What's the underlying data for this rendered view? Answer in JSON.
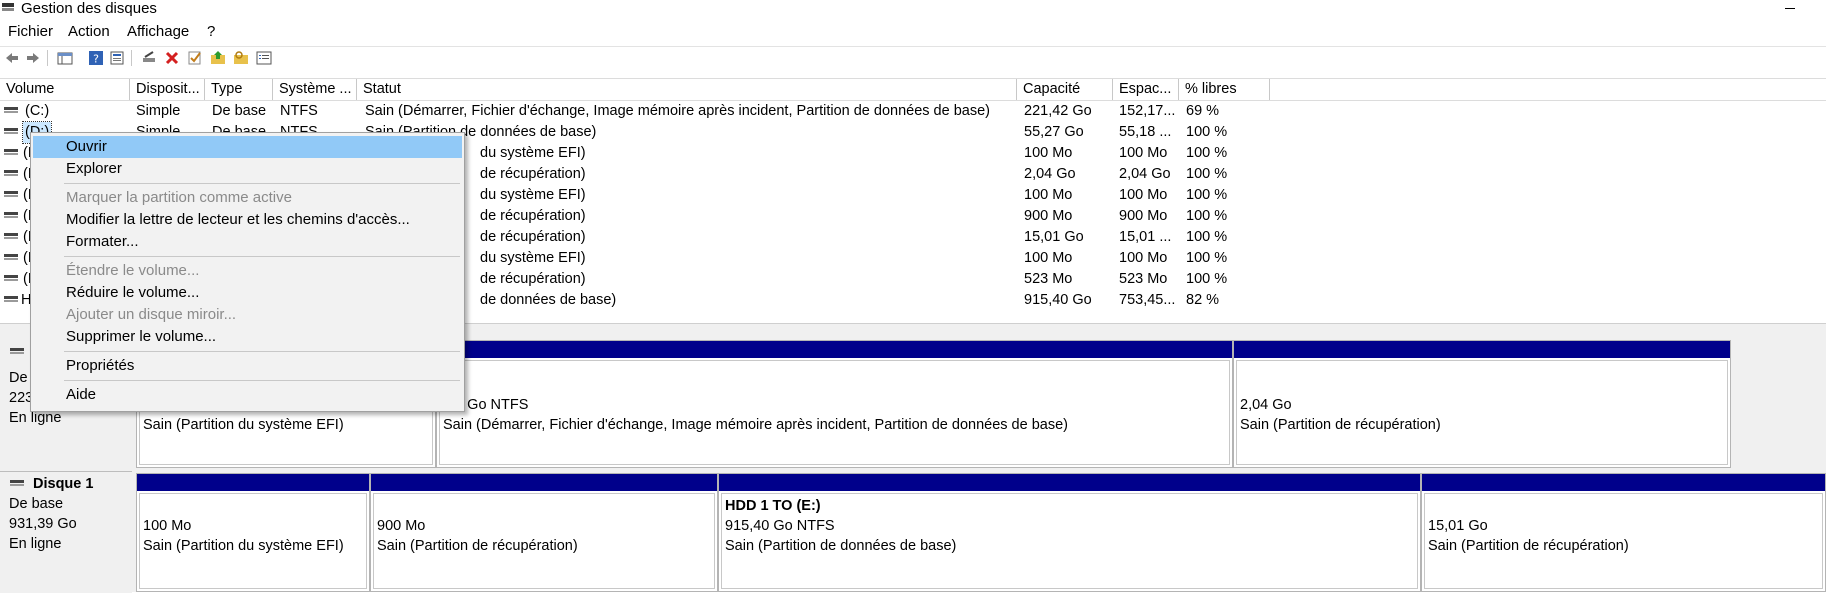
{
  "window": {
    "title": "Gestion des disques"
  },
  "menubar": [
    "Fichier",
    "Action",
    "Affichage",
    "?"
  ],
  "toolbar": {
    "icons": [
      "back-arrow-icon",
      "forward-arrow-icon",
      "console-tree-icon",
      "help-icon",
      "properties-icon",
      "connect-icon",
      "delete-icon",
      "check-icon",
      "folder-up-icon",
      "folder-key-icon",
      "list-icon"
    ]
  },
  "volume_list": {
    "columns": [
      "Volume",
      "Disposit...",
      "Type",
      "Système ...",
      "Statut",
      "Capacité",
      "Espac...",
      "% libres"
    ],
    "rows": [
      [
        "(C:)",
        "Simple",
        "De base",
        "NTFS",
        "Sain (Démarrer, Fichier d'échange, Image mémoire après incident, Partition de données de base)",
        "221,42 Go",
        "152,17...",
        "69 %"
      ],
      [
        "(D:)",
        "Simple",
        "De base",
        "NTFS",
        "Sain (Partition de données de base)",
        "55,27 Go",
        "55,18 ...",
        "100 %"
      ],
      [
        "(D",
        "",
        "",
        "",
        "du système EFI)",
        "100 Mo",
        "100 Mo",
        "100 %"
      ],
      [
        "(D",
        "",
        "",
        "",
        "de récupération)",
        "2,04 Go",
        "2,04 Go",
        "100 %"
      ],
      [
        "(D",
        "",
        "",
        "",
        "du système EFI)",
        "100 Mo",
        "100 Mo",
        "100 %"
      ],
      [
        "(D",
        "",
        "",
        "",
        "de récupération)",
        "900 Mo",
        "900 Mo",
        "100 %"
      ],
      [
        "(D",
        "",
        "",
        "",
        "de récupération)",
        "15,01 Go",
        "15,01 ...",
        "100 %"
      ],
      [
        "(D",
        "",
        "",
        "",
        "du système EFI)",
        "100 Mo",
        "100 Mo",
        "100 %"
      ],
      [
        "(D",
        "",
        "",
        "",
        "de récupération)",
        "523 Mo",
        "523 Mo",
        "100 %"
      ],
      [
        "H",
        "",
        "",
        "",
        "de données de base)",
        "915,40 Go",
        "753,45...",
        "82 %"
      ]
    ]
  },
  "context_menu": [
    {
      "label": "Ouvrir",
      "state": "highlighted"
    },
    {
      "label": "Explorer",
      "state": "enabled"
    },
    {
      "label": "Marquer la partition comme active",
      "state": "disabled"
    },
    {
      "label": "Modifier la lettre de lecteur et les chemins d'accès...",
      "state": "enabled"
    },
    {
      "label": "Formater...",
      "state": "enabled"
    },
    {
      "label": "Étendre le volume...",
      "state": "disabled"
    },
    {
      "label": "Réduire le volume...",
      "state": "enabled"
    },
    {
      "label": "Ajouter un disque miroir...",
      "state": "disabled"
    },
    {
      "label": "Supprimer le volume...",
      "state": "enabled"
    },
    {
      "label": "Propriétés",
      "state": "enabled"
    },
    {
      "label": "Aide",
      "state": "enabled"
    }
  ],
  "disk0": {
    "label": [
      "De",
      "223",
      "En ligne"
    ],
    "partitions": [
      {
        "name": "",
        "size": "",
        "status": "Sain (Partition du système EFI)"
      },
      {
        "name": ":)",
        "size": ",42 Go NTFS",
        "status": "Sain (Démarrer, Fichier d'échange, Image mémoire après incident, Partition de données de base)"
      },
      {
        "name": "",
        "size": "2,04 Go",
        "status": "Sain (Partition de récupération)"
      }
    ]
  },
  "disk1": {
    "label": [
      "Disque 1",
      "De base",
      "931,39 Go",
      "En ligne"
    ],
    "partitions": [
      {
        "name": "",
        "size": "100 Mo",
        "status": "Sain (Partition du système EFI)"
      },
      {
        "name": "",
        "size": "900 Mo",
        "status": "Sain (Partition de récupération)"
      },
      {
        "name": "HDD 1 TO  (E:)",
        "size": "915,40 Go NTFS",
        "status": "Sain (Partition de données de base)"
      },
      {
        "name": "",
        "size": "15,01 Go",
        "status": "Sain (Partition de récupération)"
      }
    ]
  },
  "colors": {
    "partition_bar": "#00008b",
    "menu_highlight": "#91c9f7",
    "selection": "#cce8ff"
  }
}
